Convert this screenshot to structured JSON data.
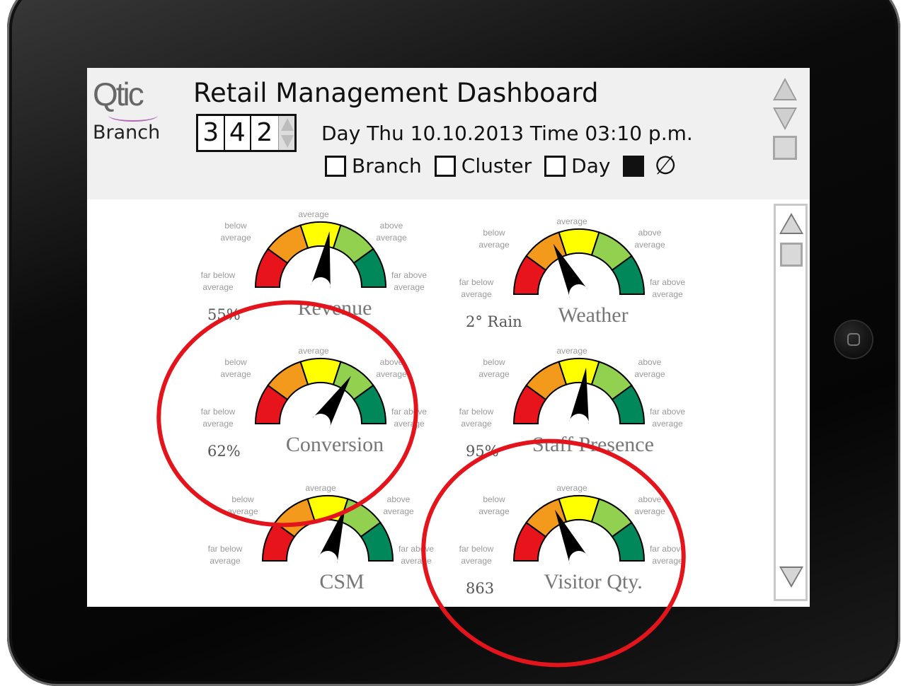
{
  "header": {
    "logo": "Qtic",
    "branch_label": "Branch",
    "title": "Retail Management Dashboard",
    "branch_digits": [
      "3",
      "4",
      "2"
    ],
    "datetime": "Day Thu 10.10.2013 Time 03:10 p.m.",
    "filters": [
      {
        "label": "Branch",
        "checked": false
      },
      {
        "label": "Cluster",
        "checked": false
      },
      {
        "label": "Day",
        "checked": false
      }
    ],
    "null_symbol": "∅"
  },
  "zone_labels": {
    "top": "average",
    "below": "below\naverage",
    "above": "above\naverage",
    "far_below": "far below\naverage",
    "far_above": "far above\naverage"
  },
  "gauges": [
    {
      "id": "revenue",
      "name": "Revenue",
      "value": "55%",
      "needle_fraction": 0.55
    },
    {
      "id": "weather",
      "name": "Weather",
      "value": "2° Rain",
      "needle_fraction": 0.35
    },
    {
      "id": "conversion",
      "name": "Conversion",
      "value": "62%",
      "needle_fraction": 0.68
    },
    {
      "id": "staff",
      "name": "Staff Presence",
      "value": "95%",
      "needle_fraction": 0.54
    },
    {
      "id": "csm",
      "name": "CSM",
      "value": "",
      "needle_fraction": 0.6
    },
    {
      "id": "visitor",
      "name": "Visitor Qty.",
      "value": "863",
      "needle_fraction": 0.36
    }
  ],
  "colors": {
    "zones": [
      "#e8141b",
      "#f39a1d",
      "#ffff00",
      "#92d050",
      "#00875a"
    ],
    "annotation": "#e3141b"
  }
}
